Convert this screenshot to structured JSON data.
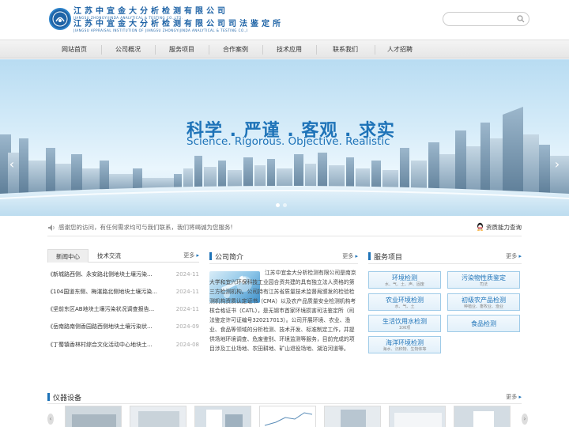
{
  "header": {
    "logo_cn_line1": "江苏中宜金大分析检测有限公司",
    "logo_en_line1": "JIANGSU ZHONGYIJINDA ANALYTICAL & TESTING CO.,LTD.",
    "logo_cn_line2": "江苏中宜金大分析检测有限公司司法鉴定所",
    "logo_en_line2": "JIANGSU APPRAISAL INSTITUTION OF JIANGSU ZHONGYIJINDA ANALYTICAL & TESTING CO.,LTD",
    "search_placeholder": ""
  },
  "nav": {
    "items": [
      "网站首页",
      "公司概况",
      "服务项目",
      "合作案例",
      "技术应用",
      "联系我们",
      "人才招聘"
    ]
  },
  "banner": {
    "slogan_cn": "科学 . 严谨 . 客观 . 求实",
    "slogan_en": "Science. Rigorous. Objective. Realistic"
  },
  "notice": {
    "text": "感谢您的访问，有任何需求均可与我们联系，我们将竭诚为您服务!",
    "consult": "资质能力查询"
  },
  "news": {
    "tabs": [
      "新闻中心",
      "技术交流"
    ],
    "more": "更多",
    "items": [
      {
        "title": "《新城路西侧、永安路北侧地块土壤污染...",
        "date": "2024-11"
      },
      {
        "title": "《104国道东侧、梅湛路北侧地块土壤污染...",
        "date": "2024-11"
      },
      {
        "title": "《坚前东区AB地块土壤污染状况调查报告...",
        "date": "2024-11"
      },
      {
        "title": "《岳南路南侧香园路西侧地块土壤污染状...",
        "date": "2024-09"
      },
      {
        "title": "《丁蜀镇香林村综合文化活动中心地块土...",
        "date": "2024-08"
      }
    ]
  },
  "about": {
    "title": "公司简介",
    "more": "更多",
    "text": "江苏中宜金大分析检测有限公司是南京大学和宜兴环保科技工业园合资共建的具有独立法人资格的第三方检测机构。公司持有江苏省质量技术监督局颁发的检验检测机构资质认定证书（CMA）以及农产品质量安全检测机构考核合格证书（CATL），是无锡市首家环境损害司法鉴定所（司法鉴定许可证编号320217013）。公司开展环境、农业、渔业、食品等领域的分析检测、技术开发、标准制定工作，并提供场地环境调查、危废鉴别、环境监测等服务，目前完成的项目涉及工业场地、农田耕地、矿山退役场地、湖泊河道等。"
  },
  "services": {
    "title": "服务项目",
    "more": "更多",
    "items": [
      {
        "name": "环境检测",
        "sub": "水、气、土、声、固废"
      },
      {
        "name": "污染物性质鉴定",
        "sub": "司法"
      },
      {
        "name": "农业环境检测",
        "sub": "水、气、土"
      },
      {
        "name": "初级农产品检测",
        "sub": "种植业、畜牧业、渔业"
      },
      {
        "name": "生活饮用水检测",
        "sub": "106项"
      },
      {
        "name": "食品检测",
        "sub": ""
      },
      {
        "name": "海洋环境检测",
        "sub": "海水、沉积物、生物体等"
      }
    ]
  },
  "instruments": {
    "title": "仪器设备",
    "more": "更多"
  },
  "colors": {
    "brand_blue": "#1e73b8",
    "nav_bg": "#eeeeee"
  }
}
